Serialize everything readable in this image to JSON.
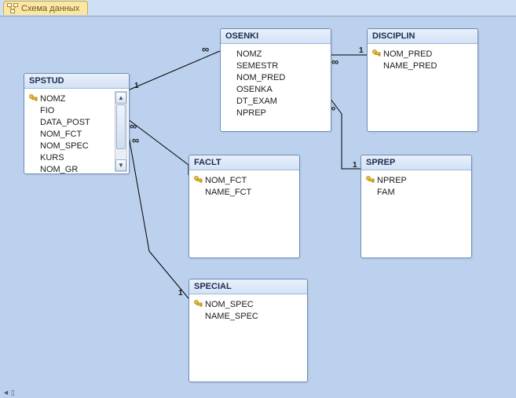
{
  "tab_title": "Схема данных",
  "tables": {
    "spstud": {
      "title": "SPSTUD",
      "fields": [
        "NOMZ",
        "FIO",
        "DATA_POST",
        "NOM_FCT",
        "NOM_SPEC",
        "KURS",
        "NOM_GR"
      ],
      "pk_index": 0
    },
    "osenki": {
      "title": "OSENKI",
      "fields": [
        "NOMZ",
        "SEMESTR",
        "NOM_PRED",
        "OSENKA",
        "DT_EXAM",
        "NPREP"
      ]
    },
    "disciplin": {
      "title": "DISCIPLIN",
      "fields": [
        "NOM_PRED",
        "NAME_PRED"
      ],
      "pk_index": 0
    },
    "faclt": {
      "title": "FACLT",
      "fields": [
        "NOM_FCT",
        "NAME_FCT"
      ],
      "pk_index": 0
    },
    "sprep": {
      "title": "SPREP",
      "fields": [
        "NPREP",
        "FAM"
      ],
      "pk_index": 0
    },
    "special": {
      "title": "SPECIAL",
      "fields": [
        "NOM_SPEC",
        "NAME_SPEC"
      ],
      "pk_index": 0
    }
  },
  "rel": {
    "one": "1",
    "many": "∞"
  }
}
